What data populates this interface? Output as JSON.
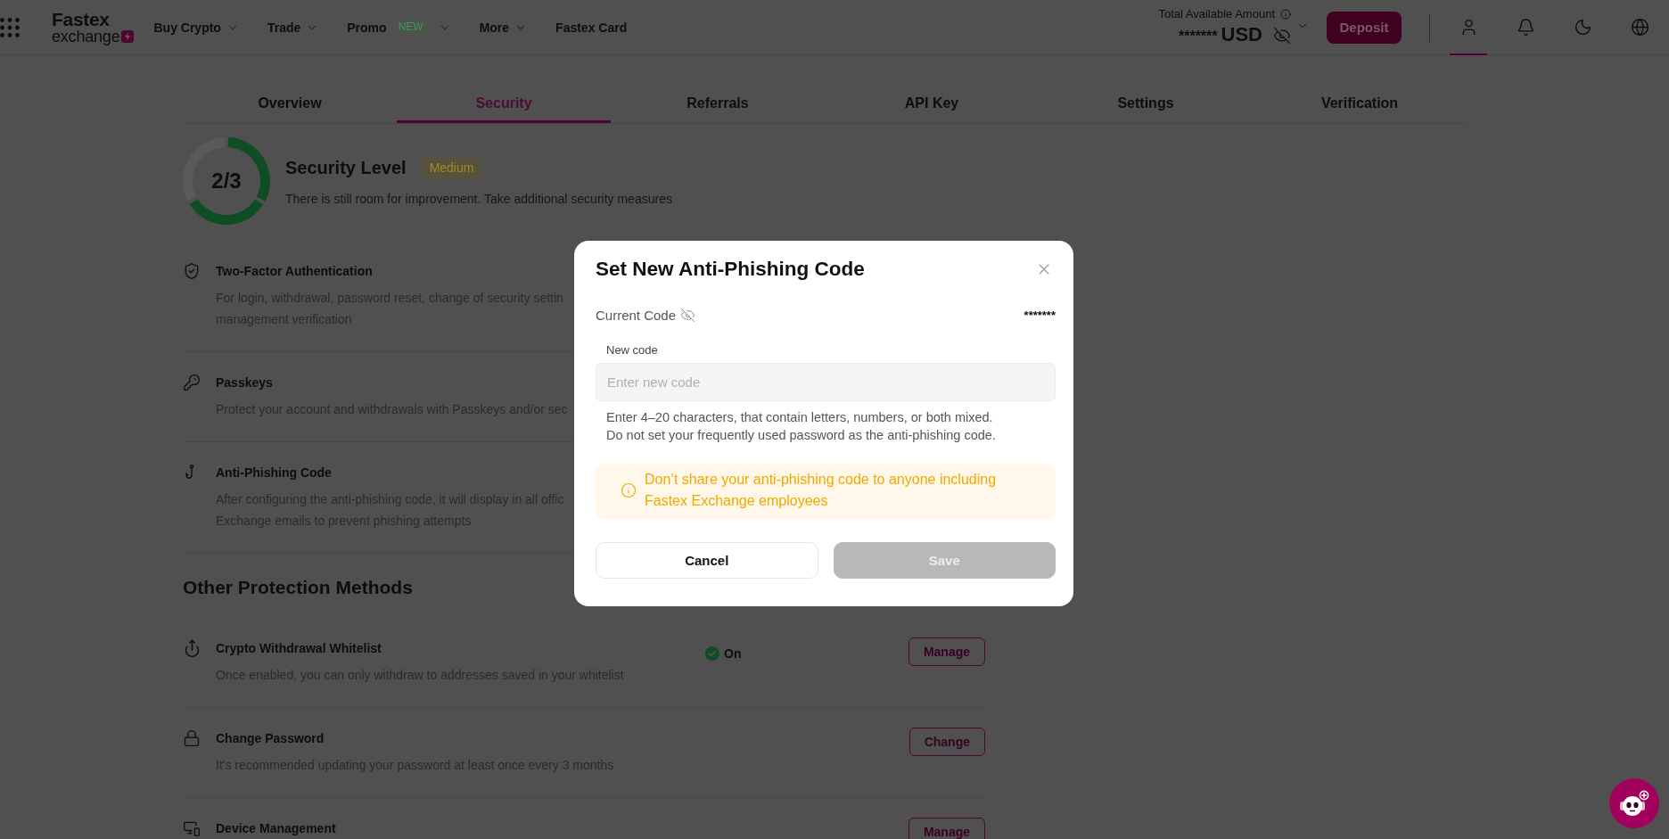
{
  "header": {
    "logo": {
      "wordmark": "Fastex",
      "tagline": "exchange"
    },
    "nav": [
      {
        "label": "Buy Crypto",
        "dropdown": true
      },
      {
        "label": "Trade",
        "dropdown": true
      },
      {
        "label": "Promo",
        "badge": "NEW",
        "dropdown": true
      },
      {
        "label": "More",
        "dropdown": true
      },
      {
        "label": "Fastex Card",
        "dropdown": false
      }
    ],
    "balance": {
      "label": "Total Available Amount",
      "amount": "*******",
      "currency": "USD",
      "hidden": true
    },
    "deposit_button": "Deposit",
    "actions": [
      {
        "kind": "profile",
        "selected": true
      },
      {
        "kind": "notifications",
        "selected": false
      },
      {
        "kind": "theme",
        "selected": false
      },
      {
        "kind": "language",
        "selected": false
      }
    ]
  },
  "tabs": [
    {
      "label": "Overview",
      "selected": false
    },
    {
      "label": "Security",
      "selected": true
    },
    {
      "label": "Referrals",
      "selected": false
    },
    {
      "label": "API Key",
      "selected": false
    },
    {
      "label": "Settings",
      "selected": false
    },
    {
      "label": "Verification",
      "selected": false
    }
  ],
  "security": {
    "score": "2/3",
    "segments": [
      {
        "filled": true
      },
      {
        "filled": true
      },
      {
        "filled": false
      }
    ],
    "title": "Security Level",
    "badge": "Medium",
    "description": "There is still room for improvement. Take additional security measures"
  },
  "security_items": [
    {
      "kind": "two_factor",
      "title": "Two-Factor Authentication",
      "description_lines": [
        "For login, withdrawal, password reset, change of security settin",
        "management verification"
      ]
    },
    {
      "kind": "passkeys",
      "title": "Passkeys",
      "description_lines": [
        "Protect your account and withdrawals with Passkeys and/or sec"
      ]
    },
    {
      "kind": "anti_phishing",
      "title": "Anti-Phishing Code",
      "description_lines": [
        "After configuring the anti-phishing code, it will display in all offic",
        "Exchange emails to prevent phishing attempts"
      ]
    }
  ],
  "other_methods": {
    "heading": "Other Protection Methods",
    "items": [
      {
        "kind": "whitelist",
        "title": "Crypto Withdrawal Whitelist",
        "description_lines": [
          "Once enabled, you can only withdraw to addresses saved in your whitelist"
        ],
        "status": {
          "label": "On",
          "enabled": true
        },
        "button": "Manage"
      },
      {
        "kind": "password",
        "title": "Change Password",
        "description_lines": [
          "It's recommended updating your password at least once every 3 months"
        ],
        "button": "Change"
      },
      {
        "kind": "devices",
        "title": "Device Management",
        "button": "Manage"
      }
    ]
  },
  "modal": {
    "title": "Set New Anti-Phishing Code",
    "current_code": {
      "label": "Current Code",
      "value": "*******",
      "masked": true
    },
    "field_label": "New code",
    "placeholder": "Enter new code",
    "hints": [
      "Enter 4–20 characters, that contain letters, numbers, or both mixed.",
      "Do not set your frequently used password as the anti-phishing code."
    ],
    "warning": "Don’t share your anti-phishing code to anyone including Fastex Exchange employees",
    "buttons": [
      {
        "label": "Cancel",
        "kind": "cancel",
        "disabled": false
      },
      {
        "label": "Save",
        "kind": "submit",
        "disabled": true
      }
    ]
  }
}
